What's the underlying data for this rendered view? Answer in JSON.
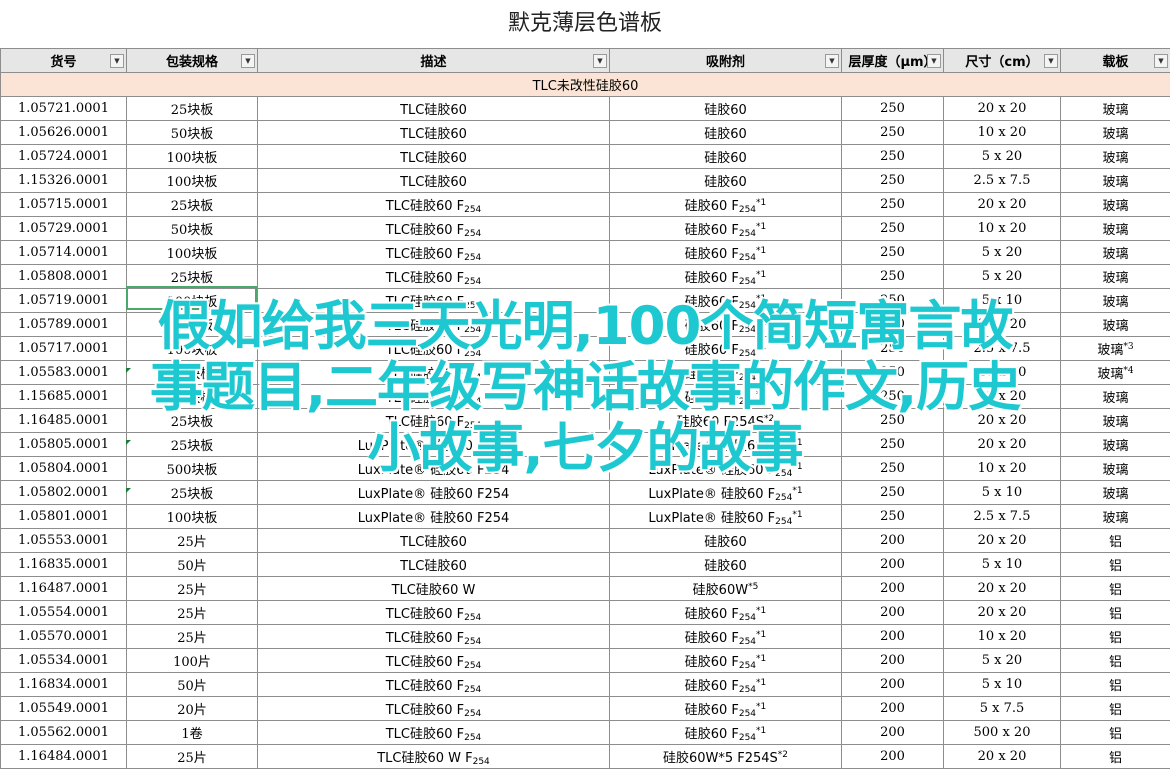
{
  "title": "默克薄层色谱板",
  "headers": [
    "货号",
    "包装规格",
    "描述",
    "吸附剂",
    "层厚度（μm）",
    "尺寸（cm）",
    "载板"
  ],
  "group_label": "TLC未改性硅胶60",
  "rows": [
    {
      "code": "1.05721.0001",
      "pack": "25块板",
      "desc": "TLC硅胶60",
      "desc_sub": "",
      "abs": "硅胶60",
      "abs_sub": "",
      "abs_sup": "",
      "thick": "250",
      "size": "20 x 20",
      "carrier": "玻璃",
      "carrier_sup": ""
    },
    {
      "code": "1.05626.0001",
      "pack": "50块板",
      "desc": "TLC硅胶60",
      "desc_sub": "",
      "abs": "硅胶60",
      "abs_sub": "",
      "abs_sup": "",
      "thick": "250",
      "size": "10 x 20",
      "carrier": "玻璃",
      "carrier_sup": ""
    },
    {
      "code": "1.05724.0001",
      "pack": "100块板",
      "desc": "TLC硅胶60",
      "desc_sub": "",
      "abs": "硅胶60",
      "abs_sub": "",
      "abs_sup": "",
      "thick": "250",
      "size": "5 x 20",
      "carrier": "玻璃",
      "carrier_sup": ""
    },
    {
      "code": "1.15326.0001",
      "pack": "100块板",
      "desc": "TLC硅胶60",
      "desc_sub": "",
      "abs": "硅胶60",
      "abs_sub": "",
      "abs_sup": "",
      "thick": "250",
      "size": "2.5 x 7.5",
      "carrier": "玻璃",
      "carrier_sup": ""
    },
    {
      "code": "1.05715.0001",
      "pack": "25块板",
      "desc": "TLC硅胶60 F",
      "desc_sub": "254",
      "abs": "硅胶60 F",
      "abs_sub": "254",
      "abs_sup": "*1",
      "thick": "250",
      "size": "20 x 20",
      "carrier": "玻璃",
      "carrier_sup": ""
    },
    {
      "code": "1.05729.0001",
      "pack": "50块板",
      "desc": "TLC硅胶60 F",
      "desc_sub": "254",
      "abs": "硅胶60 F",
      "abs_sub": "254",
      "abs_sup": "*1",
      "thick": "250",
      "size": "10 x 20",
      "carrier": "玻璃",
      "carrier_sup": ""
    },
    {
      "code": "1.05714.0001",
      "pack": "100块板",
      "desc": "TLC硅胶60 F",
      "desc_sub": "254",
      "abs": "硅胶60 F",
      "abs_sub": "254",
      "abs_sup": "*1",
      "thick": "250",
      "size": "5 x 20",
      "carrier": "玻璃",
      "carrier_sup": ""
    },
    {
      "code": "1.05808.0001",
      "pack": "25块板",
      "desc": "TLC硅胶60 F",
      "desc_sub": "254",
      "abs": "硅胶60 F",
      "abs_sub": "254",
      "abs_sup": "*1",
      "thick": "250",
      "size": "5 x 20",
      "carrier": "玻璃",
      "carrier_sup": ""
    },
    {
      "code": "1.05719.0001",
      "pack": "200块板",
      "desc": "TLC硅胶60 F",
      "desc_sub": "254",
      "abs": "硅胶60 F",
      "abs_sub": "254",
      "abs_sup": "*1",
      "thick": "250",
      "size": "5 x 10",
      "carrier": "玻璃",
      "carrier_sup": ""
    },
    {
      "code": "1.05789.0001",
      "pack": "25块板",
      "desc": "TLC硅胶60 F",
      "desc_sub": "254",
      "abs": "硅胶60 F",
      "abs_sub": "254",
      "abs_sup": "*1",
      "thick": "250",
      "size": "20 x 20",
      "carrier": "玻璃",
      "carrier_sup": ""
    },
    {
      "code": "1.05717.0001",
      "pack": "100块板",
      "desc": "TLC硅胶60 F",
      "desc_sub": "254",
      "abs": "硅胶60 F",
      "abs_sub": "254",
      "abs_sup": "*1",
      "thick": "250",
      "size": "2.5 x 7.5",
      "carrier": "玻璃",
      "carrier_sup": "*3"
    },
    {
      "code": "1.05583.0001",
      "pack": "25块板",
      "desc": "TLC硅胶60 F",
      "desc_sub": "254",
      "abs": "硅胶60 F",
      "abs_sub": "254",
      "abs_sup": "*1",
      "thick": "250",
      "size": "20 x 20",
      "carrier": "玻璃",
      "carrier_sup": "*4"
    },
    {
      "code": "1.15685.0001",
      "pack": "50块板",
      "desc": "TLC硅胶60 F",
      "desc_sub": "254",
      "abs": "硅胶60 F",
      "abs_sub": "254",
      "abs_sup": "*1",
      "thick": "250",
      "size": "10 x 20",
      "carrier": "玻璃",
      "carrier_sup": ""
    },
    {
      "code": "1.16485.0001",
      "pack": "25块板",
      "desc": "TLC硅胶60 F",
      "desc_sub": "254",
      "abs": "硅胶60 F254S",
      "abs_sub": "",
      "abs_sup": "*2",
      "thick": "250",
      "size": "20 x 20",
      "carrier": "玻璃",
      "carrier_sup": ""
    },
    {
      "code": "1.05805.0001",
      "pack": "25块板",
      "desc": "LuxPlate® 硅胶60 F254",
      "desc_sub": "",
      "abs": "LuxPlate® 硅胶60 F",
      "abs_sub": "254",
      "abs_sup": "*1",
      "thick": "250",
      "size": "20 x 20",
      "carrier": "玻璃",
      "carrier_sup": ""
    },
    {
      "code": "1.05804.0001",
      "pack": "500块板",
      "desc": "LuxPlate® 硅胶60 F254",
      "desc_sub": "",
      "abs": "LuxPlate® 硅胶60 F",
      "abs_sub": "254",
      "abs_sup": "*1",
      "thick": "250",
      "size": "10 x 20",
      "carrier": "玻璃",
      "carrier_sup": ""
    },
    {
      "code": "1.05802.0001",
      "pack": "25块板",
      "desc": "LuxPlate® 硅胶60 F254",
      "desc_sub": "",
      "abs": "LuxPlate® 硅胶60 F",
      "abs_sub": "254",
      "abs_sup": "*1",
      "thick": "250",
      "size": "5 x 10",
      "carrier": "玻璃",
      "carrier_sup": ""
    },
    {
      "code": "1.05801.0001",
      "pack": "100块板",
      "desc": "LuxPlate® 硅胶60 F254",
      "desc_sub": "",
      "abs": "LuxPlate® 硅胶60 F",
      "abs_sub": "254",
      "abs_sup": "*1",
      "thick": "250",
      "size": "2.5 x 7.5",
      "carrier": "玻璃",
      "carrier_sup": ""
    },
    {
      "code": "1.05553.0001",
      "pack": "25片",
      "desc": "TLC硅胶60",
      "desc_sub": "",
      "abs": "硅胶60",
      "abs_sub": "",
      "abs_sup": "",
      "thick": "200",
      "size": "20 x 20",
      "carrier": "铝",
      "carrier_sup": ""
    },
    {
      "code": "1.16835.0001",
      "pack": "50片",
      "desc": "TLC硅胶60",
      "desc_sub": "",
      "abs": "硅胶60",
      "abs_sub": "",
      "abs_sup": "",
      "thick": "200",
      "size": "5 x 10",
      "carrier": "铝",
      "carrier_sup": ""
    },
    {
      "code": "1.16487.0001",
      "pack": "25片",
      "desc": "TLC硅胶60 W",
      "desc_sub": "",
      "abs": "硅胶60W",
      "abs_sub": "",
      "abs_sup": "*5",
      "thick": "200",
      "size": "20 x 20",
      "carrier": "铝",
      "carrier_sup": ""
    },
    {
      "code": "1.05554.0001",
      "pack": "25片",
      "desc": "TLC硅胶60 F",
      "desc_sub": "254",
      "abs": "硅胶60 F",
      "abs_sub": "254",
      "abs_sup": "*1",
      "thick": "200",
      "size": "20 x 20",
      "carrier": "铝",
      "carrier_sup": ""
    },
    {
      "code": "1.05570.0001",
      "pack": "25片",
      "desc": "TLC硅胶60 F",
      "desc_sub": "254",
      "abs": "硅胶60 F",
      "abs_sub": "254",
      "abs_sup": "*1",
      "thick": "200",
      "size": "10 x 20",
      "carrier": "铝",
      "carrier_sup": ""
    },
    {
      "code": "1.05534.0001",
      "pack": "100片",
      "desc": "TLC硅胶60 F",
      "desc_sub": "254",
      "abs": "硅胶60 F",
      "abs_sub": "254",
      "abs_sup": "*1",
      "thick": "200",
      "size": "5 x 20",
      "carrier": "铝",
      "carrier_sup": ""
    },
    {
      "code": "1.16834.0001",
      "pack": "50片",
      "desc": "TLC硅胶60 F",
      "desc_sub": "254",
      "abs": "硅胶60 F",
      "abs_sub": "254",
      "abs_sup": "*1",
      "thick": "200",
      "size": "5 x 10",
      "carrier": "铝",
      "carrier_sup": ""
    },
    {
      "code": "1.05549.0001",
      "pack": "20片",
      "desc": "TLC硅胶60 F",
      "desc_sub": "254",
      "abs": "硅胶60 F",
      "abs_sub": "254",
      "abs_sup": "*1",
      "thick": "200",
      "size": "5 x 7.5",
      "carrier": "铝",
      "carrier_sup": ""
    },
    {
      "code": "1.05562.0001",
      "pack": "1卷",
      "desc": "TLC硅胶60 F",
      "desc_sub": "254",
      "abs": "硅胶60 F",
      "abs_sub": "254",
      "abs_sup": "*1",
      "thick": "200",
      "size": "500 x 20",
      "carrier": "铝",
      "carrier_sup": ""
    },
    {
      "code": "1.16484.0001",
      "pack": "25片",
      "desc": "TLC硅胶60 W F",
      "desc_sub": "254",
      "abs": "硅胶60W*5 F254S",
      "abs_sub": "",
      "abs_sup": "*2",
      "thick": "200",
      "size": "20 x 20",
      "carrier": "铝",
      "carrier_sup": ""
    }
  ],
  "overlay_lines": [
    "假如给我三天光明,100个简短寓言故",
    "事题目,二年级写神话故事的作文,历史",
    "小故事,七夕的故事"
  ]
}
